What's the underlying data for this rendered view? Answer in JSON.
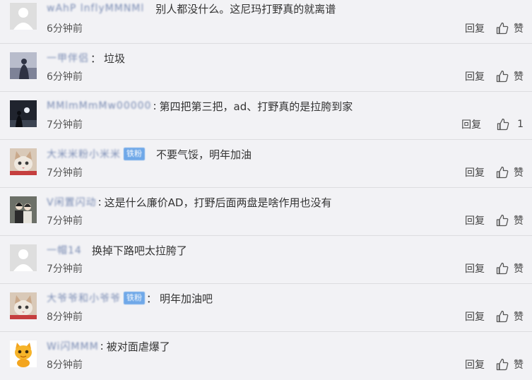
{
  "comments": [
    {
      "username": "wAhP lnflyMMNMl",
      "badge": "",
      "separator": "",
      "text": "别人都没什么。这尼玛打野真的就离谱",
      "time": "6分钟前",
      "reply": "回复",
      "like": "赞",
      "avatar": "default-avatar"
    },
    {
      "username": "一甲伴侣",
      "badge": "",
      "separator": "：",
      "text": "垃圾",
      "time": "6分钟前",
      "reply": "回复",
      "like": "赞",
      "avatar": "silhouette-avatar"
    },
    {
      "username": "MMlmMmMw00000",
      "badge": "",
      "separator": ":",
      "text": "第四把第三把，ad、打野真的是拉胯到家",
      "time": "7分钟前",
      "reply": "回复",
      "like": "1",
      "avatar": "night-avatar"
    },
    {
      "username": "大米米粉小米米",
      "badge": "铁粉",
      "separator": "",
      "text": "不要气馁，明年加油",
      "time": "7分钟前",
      "reply": "回复",
      "like": "赞",
      "avatar": "cat-avatar"
    },
    {
      "username": "V闲置闪动",
      "badge": "",
      "separator": ":",
      "text": "这是什么廉价AD，打野后面两盘是啥作用也没有",
      "time": "7分钟前",
      "reply": "回复",
      "like": "赞",
      "avatar": "couple-avatar"
    },
    {
      "username": "一帽14",
      "badge": "",
      "separator": "",
      "text": "换掉下路吧太拉胯了",
      "time": "7分钟前",
      "reply": "回复",
      "like": "赞",
      "avatar": "default-avatar"
    },
    {
      "username": "大爷爷和小爷爷",
      "badge": "铁粉",
      "separator": "：",
      "text": "明年加油吧",
      "time": "8分钟前",
      "reply": "回复",
      "like": "赞",
      "avatar": "cat-avatar"
    },
    {
      "username": "Wi闪MMM",
      "badge": "",
      "separator": ":",
      "text": "被对面虐爆了",
      "time": "8分钟前",
      "reply": "回复",
      "like": "赞",
      "avatar": "cartoon-cat-avatar"
    }
  ]
}
